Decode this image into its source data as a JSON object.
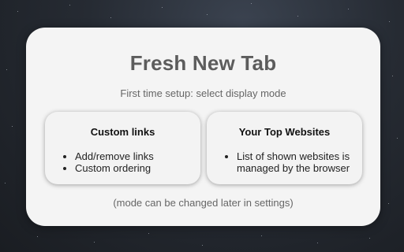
{
  "setup": {
    "title": "Fresh New Tab",
    "subtitle": "First time setup: select display mode",
    "footnote": "(mode can be changed later in settings)"
  },
  "modes": [
    {
      "title": "Custom links",
      "items": [
        "Add/remove links",
        "Custom ordering"
      ]
    },
    {
      "title": "Your Top Websites",
      "items": [
        "List of shown websites is managed by the browser"
      ]
    }
  ],
  "colors": {
    "card_background": "#f4f4f4",
    "title_text": "#5c5c5c",
    "muted_text": "#666666",
    "page_background": "#262b33"
  }
}
